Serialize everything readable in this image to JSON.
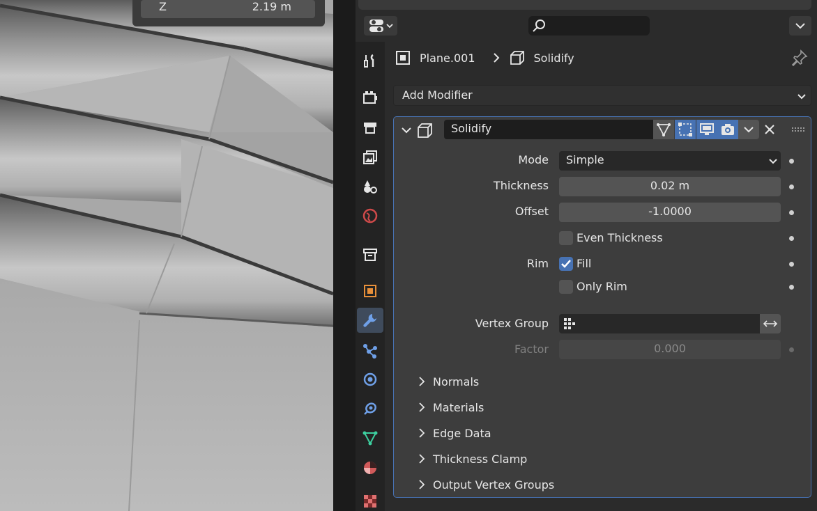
{
  "viewport": {
    "z_label": "Z",
    "z_value": "2.19 m"
  },
  "topbar": {
    "editor_type_icon": "properties-editor-icon",
    "search_icon": "search-icon",
    "options_icon": "chevron-down-icon"
  },
  "tabs": [
    {
      "name": "tool-tab",
      "icon": "tool-icon"
    },
    {
      "name": "render-tab",
      "icon": "render-icon"
    },
    {
      "name": "output-tab",
      "icon": "output-icon"
    },
    {
      "name": "view-layer-tab",
      "icon": "view-layer-icon"
    },
    {
      "name": "scene-tab",
      "icon": "scene-icon"
    },
    {
      "name": "world-tab",
      "icon": "world-icon"
    },
    {
      "name": "collection-tab",
      "icon": "collection-icon"
    },
    {
      "name": "object-tab",
      "icon": "object-icon"
    },
    {
      "name": "modifiers-tab",
      "icon": "wrench-icon",
      "active": true
    },
    {
      "name": "particles-tab",
      "icon": "particles-icon"
    },
    {
      "name": "physics-tab",
      "icon": "physics-icon"
    },
    {
      "name": "constraints-tab",
      "icon": "constraints-icon"
    },
    {
      "name": "data-tab",
      "icon": "mesh-data-icon"
    },
    {
      "name": "material-tab",
      "icon": "material-icon"
    },
    {
      "name": "texture-tab",
      "icon": "texture-icon"
    }
  ],
  "breadcrumb": {
    "object": "Plane.001",
    "separator": ">",
    "modifier": "Solidify"
  },
  "add_modifier": {
    "label": "Add Modifier"
  },
  "modifier": {
    "name": "Solidify",
    "mode": {
      "label": "Mode",
      "value": "Simple"
    },
    "thickness": {
      "label": "Thickness",
      "value": "0.02 m"
    },
    "offset": {
      "label": "Offset",
      "value": "-1.0000"
    },
    "even_thickness": {
      "label": "Even Thickness",
      "checked": false
    },
    "rim": {
      "label": "Rim"
    },
    "fill": {
      "label": "Fill",
      "checked": true
    },
    "only_rim": {
      "label": "Only Rim",
      "checked": false
    },
    "vertex_group": {
      "label": "Vertex Group",
      "value": ""
    },
    "factor": {
      "label": "Factor",
      "value": "0.000"
    },
    "subpanels": [
      "Normals",
      "Materials",
      "Edge Data",
      "Thickness Clamp",
      "Output Vertex Groups"
    ]
  },
  "colors": {
    "accent": "#4772b3",
    "panel": "#3d3d3d",
    "field": "#545454"
  }
}
